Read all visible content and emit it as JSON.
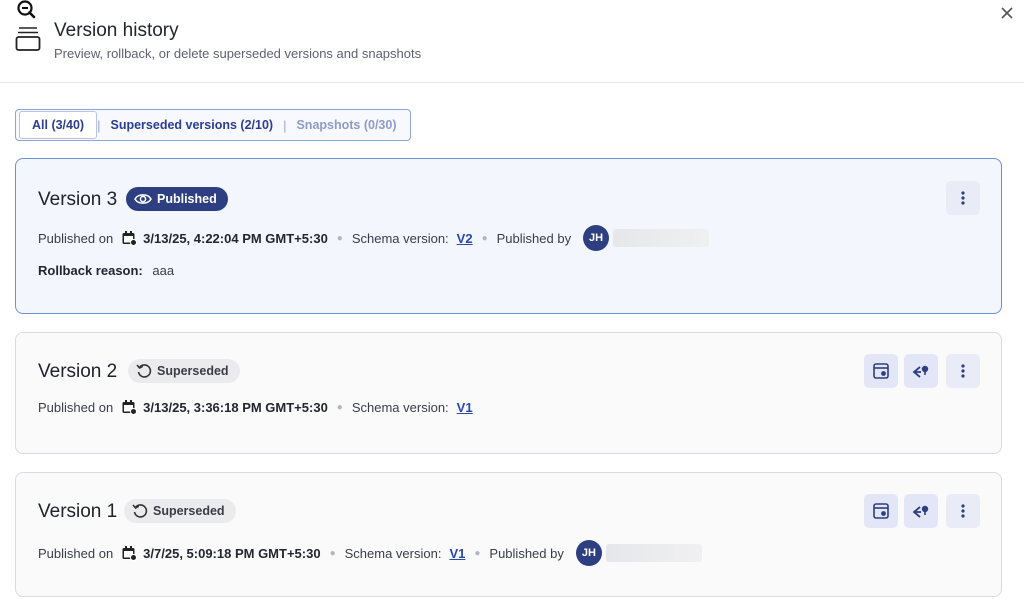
{
  "header": {
    "title": "Version history",
    "subtitle": "Preview, rollback, or delete superseded versions and snapshots"
  },
  "tabs": [
    {
      "label": "All (3/40)"
    },
    {
      "label": "Superseded versions (2/10)"
    },
    {
      "label": "Snapshots (0/30)"
    }
  ],
  "versions": [
    {
      "title": "Version 3",
      "status": "Published",
      "published_label": "Published on",
      "date": "3/13/25, 4:22:04 PM GMT+5:30",
      "schema_label": "Schema version:",
      "schema": "V2",
      "published_by_label": "Published by",
      "avatar": "JH",
      "reason_label": "Rollback reason:",
      "reason": "aaa"
    },
    {
      "title": "Version 2",
      "status": "Superseded",
      "published_label": "Published on",
      "date": "3/13/25, 3:36:18 PM GMT+5:30",
      "schema_label": "Schema version:",
      "schema": "V1"
    },
    {
      "title": "Version 1",
      "status": "Superseded",
      "published_label": "Published on",
      "date": "3/7/25, 5:09:18 PM GMT+5:30",
      "schema_label": "Schema version:",
      "schema": "V1",
      "published_by_label": "Published by",
      "avatar": "JH"
    }
  ],
  "colors": {
    "accent": "#2d3f80",
    "link": "#2948a8",
    "selected_border": "#6f8ed6",
    "icon_button_bg": "#e2e6f6"
  },
  "icons": [
    "zoom-out-icon",
    "history-icon",
    "close-icon",
    "eye-icon",
    "undo-icon",
    "calendar-icon",
    "preview-icon",
    "rollback-icon",
    "more-icon"
  ]
}
